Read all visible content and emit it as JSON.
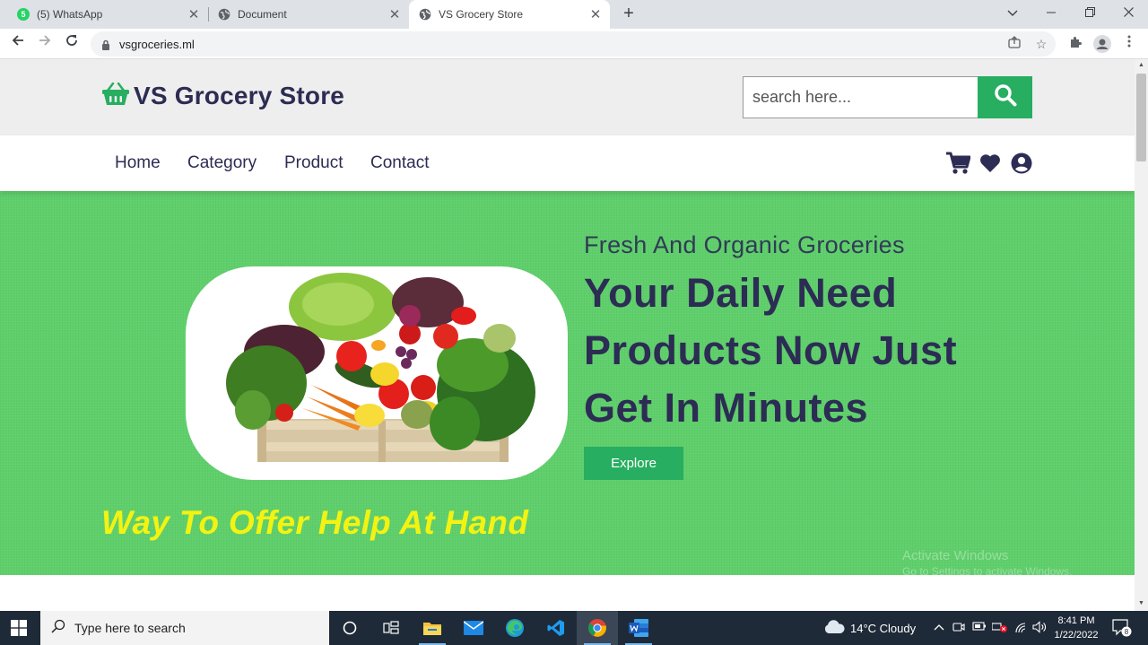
{
  "browser": {
    "tabs": [
      {
        "title": "(5) WhatsApp",
        "icon": "whatsapp-icon",
        "active": false
      },
      {
        "title": "Document",
        "icon": "globe-icon",
        "active": false
      },
      {
        "title": "VS Grocery Store",
        "icon": "globe-icon",
        "active": true
      }
    ],
    "whatsapp_badge": "5",
    "url": "vsgroceries.ml"
  },
  "site": {
    "brand": "VS Grocery Store",
    "search_placeholder": "search here...",
    "nav": [
      "Home",
      "Category",
      "Product",
      "Contact"
    ],
    "colors": {
      "accent": "#27ae60",
      "text": "#2c2c54",
      "hero_bg": "#5fcf6b",
      "tagline": "#f3f312"
    }
  },
  "hero": {
    "subtitle": "Fresh And Organic Groceries",
    "heading_lines": [
      "Your Daily Need",
      "Products Now Just",
      "Get In Minutes"
    ],
    "button": "Explore",
    "tagline": "Way To Offer Help At Hand"
  },
  "watermark": {
    "line1": "Activate Windows",
    "line2": "Go to Settings to activate Windows."
  },
  "taskbar": {
    "search_placeholder": "Type here to search",
    "weather": "14°C  Cloudy",
    "time": "8:41 PM",
    "date": "1/22/2022",
    "notification_count": "8"
  }
}
